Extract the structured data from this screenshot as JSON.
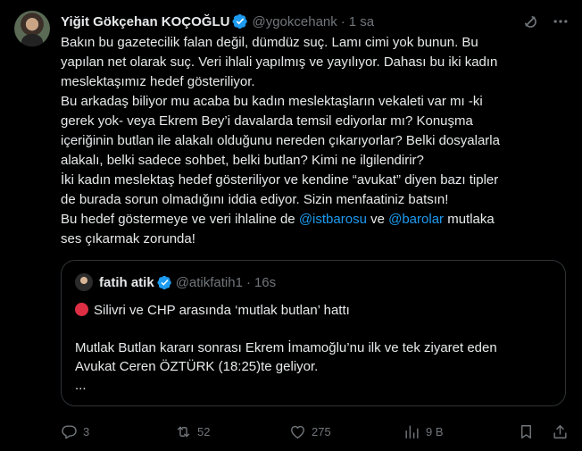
{
  "tweet": {
    "author_name": "Yiğit Gökçehan KOÇOĞLU",
    "handle": "@ygokcehank",
    "separator": "·",
    "time": "1 sa",
    "lines": [
      "Bakın bu gazetecilik falan değil, dümdüz suç. Lamı cimi yok bunun. Bu",
      "yapılan net olarak suç. Veri ihlali yapılmış ve yayılıyor. Dahası bu iki kadın",
      "meslektaşımız hedef gösteriliyor.",
      "Bu arkadaş biliyor mu acaba bu kadın meslektaşların vekaleti var mı -ki",
      "gerek yok- veya Ekrem Bey’i davalarda temsil ediyorlar mı? Konuşma",
      "içeriğinin butlan ile alakalı olduğunu nereden çıkarıyorlar? Belki dosyalarla",
      "alakalı, belki sadece sohbet, belki butlan? Kimi ne ilgilendirir?",
      "İki kadın meslektaş hedef gösteriliyor ve kendine “avukat” diyen bazı tipler",
      "de burada sorun olmadığını iddia ediyor. Sizin menfaatiniz batsın!"
    ],
    "last_line_prefix": "Bu hedef göstermeye ve veri ihlaline de ",
    "mention_1": "@istbarosu",
    "last_line_middle": " ve ",
    "mention_2": "@barolar",
    "last_line_suffix": " mutlaka",
    "final_line": "ses çıkarmak zorunda!"
  },
  "quote": {
    "author_name": "fatih atik",
    "handle": "@atikfatih1",
    "separator": "·",
    "time": "16s",
    "headline": "Silivri ve CHP arasında ‘mutlak butlan’ hattı",
    "line_1": "Mutlak Butlan kararı sonrası Ekrem İmamoğlu’nu ilk ve tek ziyaret eden",
    "line_2": "Avukat Ceren ÖZTÜRK (18:25)te geliyor.",
    "ellipsis": "..."
  },
  "actions": {
    "replies": "3",
    "retweets": "52",
    "likes": "275",
    "views": "9 B"
  },
  "colors": {
    "background": "#000000",
    "text": "#e7e9ea",
    "muted": "#71767b",
    "link": "#1d9bf0",
    "verified": "#1d9bf0",
    "border": "#2f3336",
    "red_circle": "#dd2e44"
  },
  "icons": [
    "verified-badge-icon",
    "grok-icon",
    "more-icon",
    "reply-icon",
    "retweet-icon",
    "like-icon",
    "views-icon",
    "bookmark-icon",
    "share-icon",
    "red-circle-emoji"
  ]
}
